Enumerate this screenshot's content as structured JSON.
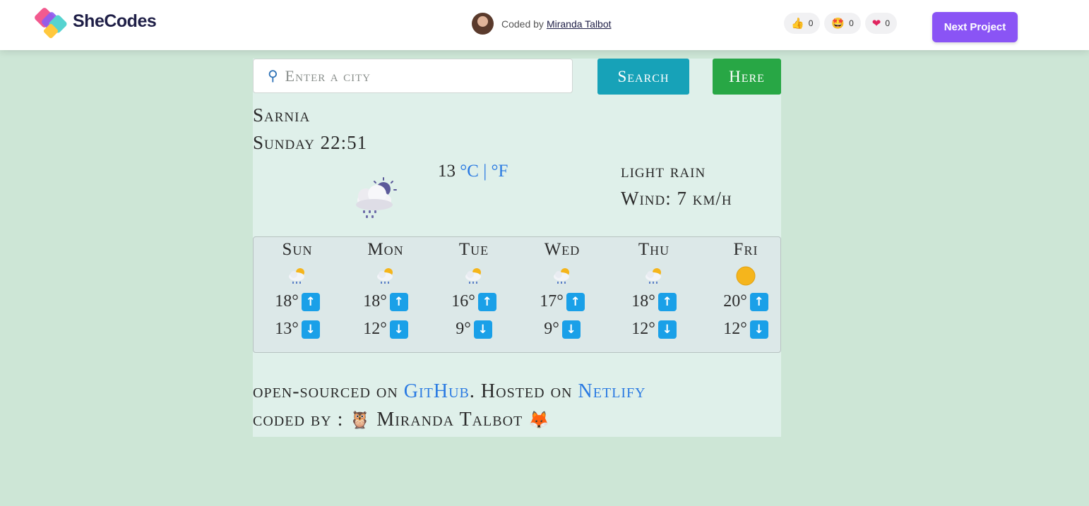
{
  "header": {
    "brand": "SheCodes",
    "coded_by_prefix": "Coded by",
    "author": "Miranda Talbot",
    "reactions": [
      {
        "icon": "thumbs-up-icon",
        "glyph": "👍",
        "count": "0"
      },
      {
        "icon": "star-struck-icon",
        "glyph": "🤩",
        "count": "0"
      },
      {
        "icon": "heart-icon",
        "glyph": "❤",
        "count": "0"
      }
    ],
    "next_label": "Next Project"
  },
  "search": {
    "placeholder": "Enter a city",
    "search_label": "Search",
    "here_label": "Here"
  },
  "current": {
    "city": "Sarnia",
    "datetime": "Sunday 22:51",
    "temp": "13",
    "unit_c": "°C",
    "separator": "|",
    "unit_f": "°F",
    "description": "light rain",
    "wind": "Wind: 7 km/h",
    "icon": "rain-cloud-moon-icon"
  },
  "forecast": [
    {
      "day": "Sun",
      "icon": "rain-cloud-sun-icon",
      "high": "18°",
      "low": "13°"
    },
    {
      "day": "Mon",
      "icon": "rain-cloud-sun-icon",
      "high": "18°",
      "low": "12°"
    },
    {
      "day": "Tue",
      "icon": "rain-cloud-sun-icon",
      "high": "16°",
      "low": "9°"
    },
    {
      "day": "Wed",
      "icon": "rain-cloud-sun-icon",
      "high": "17°",
      "low": "9°"
    },
    {
      "day": "Thu",
      "icon": "rain-cloud-sun-icon",
      "high": "18°",
      "low": "12°"
    },
    {
      "day": "Fri",
      "icon": "sun-icon",
      "high": "20°",
      "low": "12°"
    }
  ],
  "footer": {
    "open_sourced": "open-sourced on",
    "github": "GitHub",
    "hosted": ". Hosted on",
    "netlify": "Netlify",
    "coded_by": "coded by :",
    "author": "Miranda Talbot"
  },
  "colors": {
    "background": "#cde6d6",
    "panel": "#dff0ea",
    "search_button": "#17a2b8",
    "here_button": "#28a745",
    "next_button": "#8a54f5",
    "link": "#2a7ae2"
  }
}
